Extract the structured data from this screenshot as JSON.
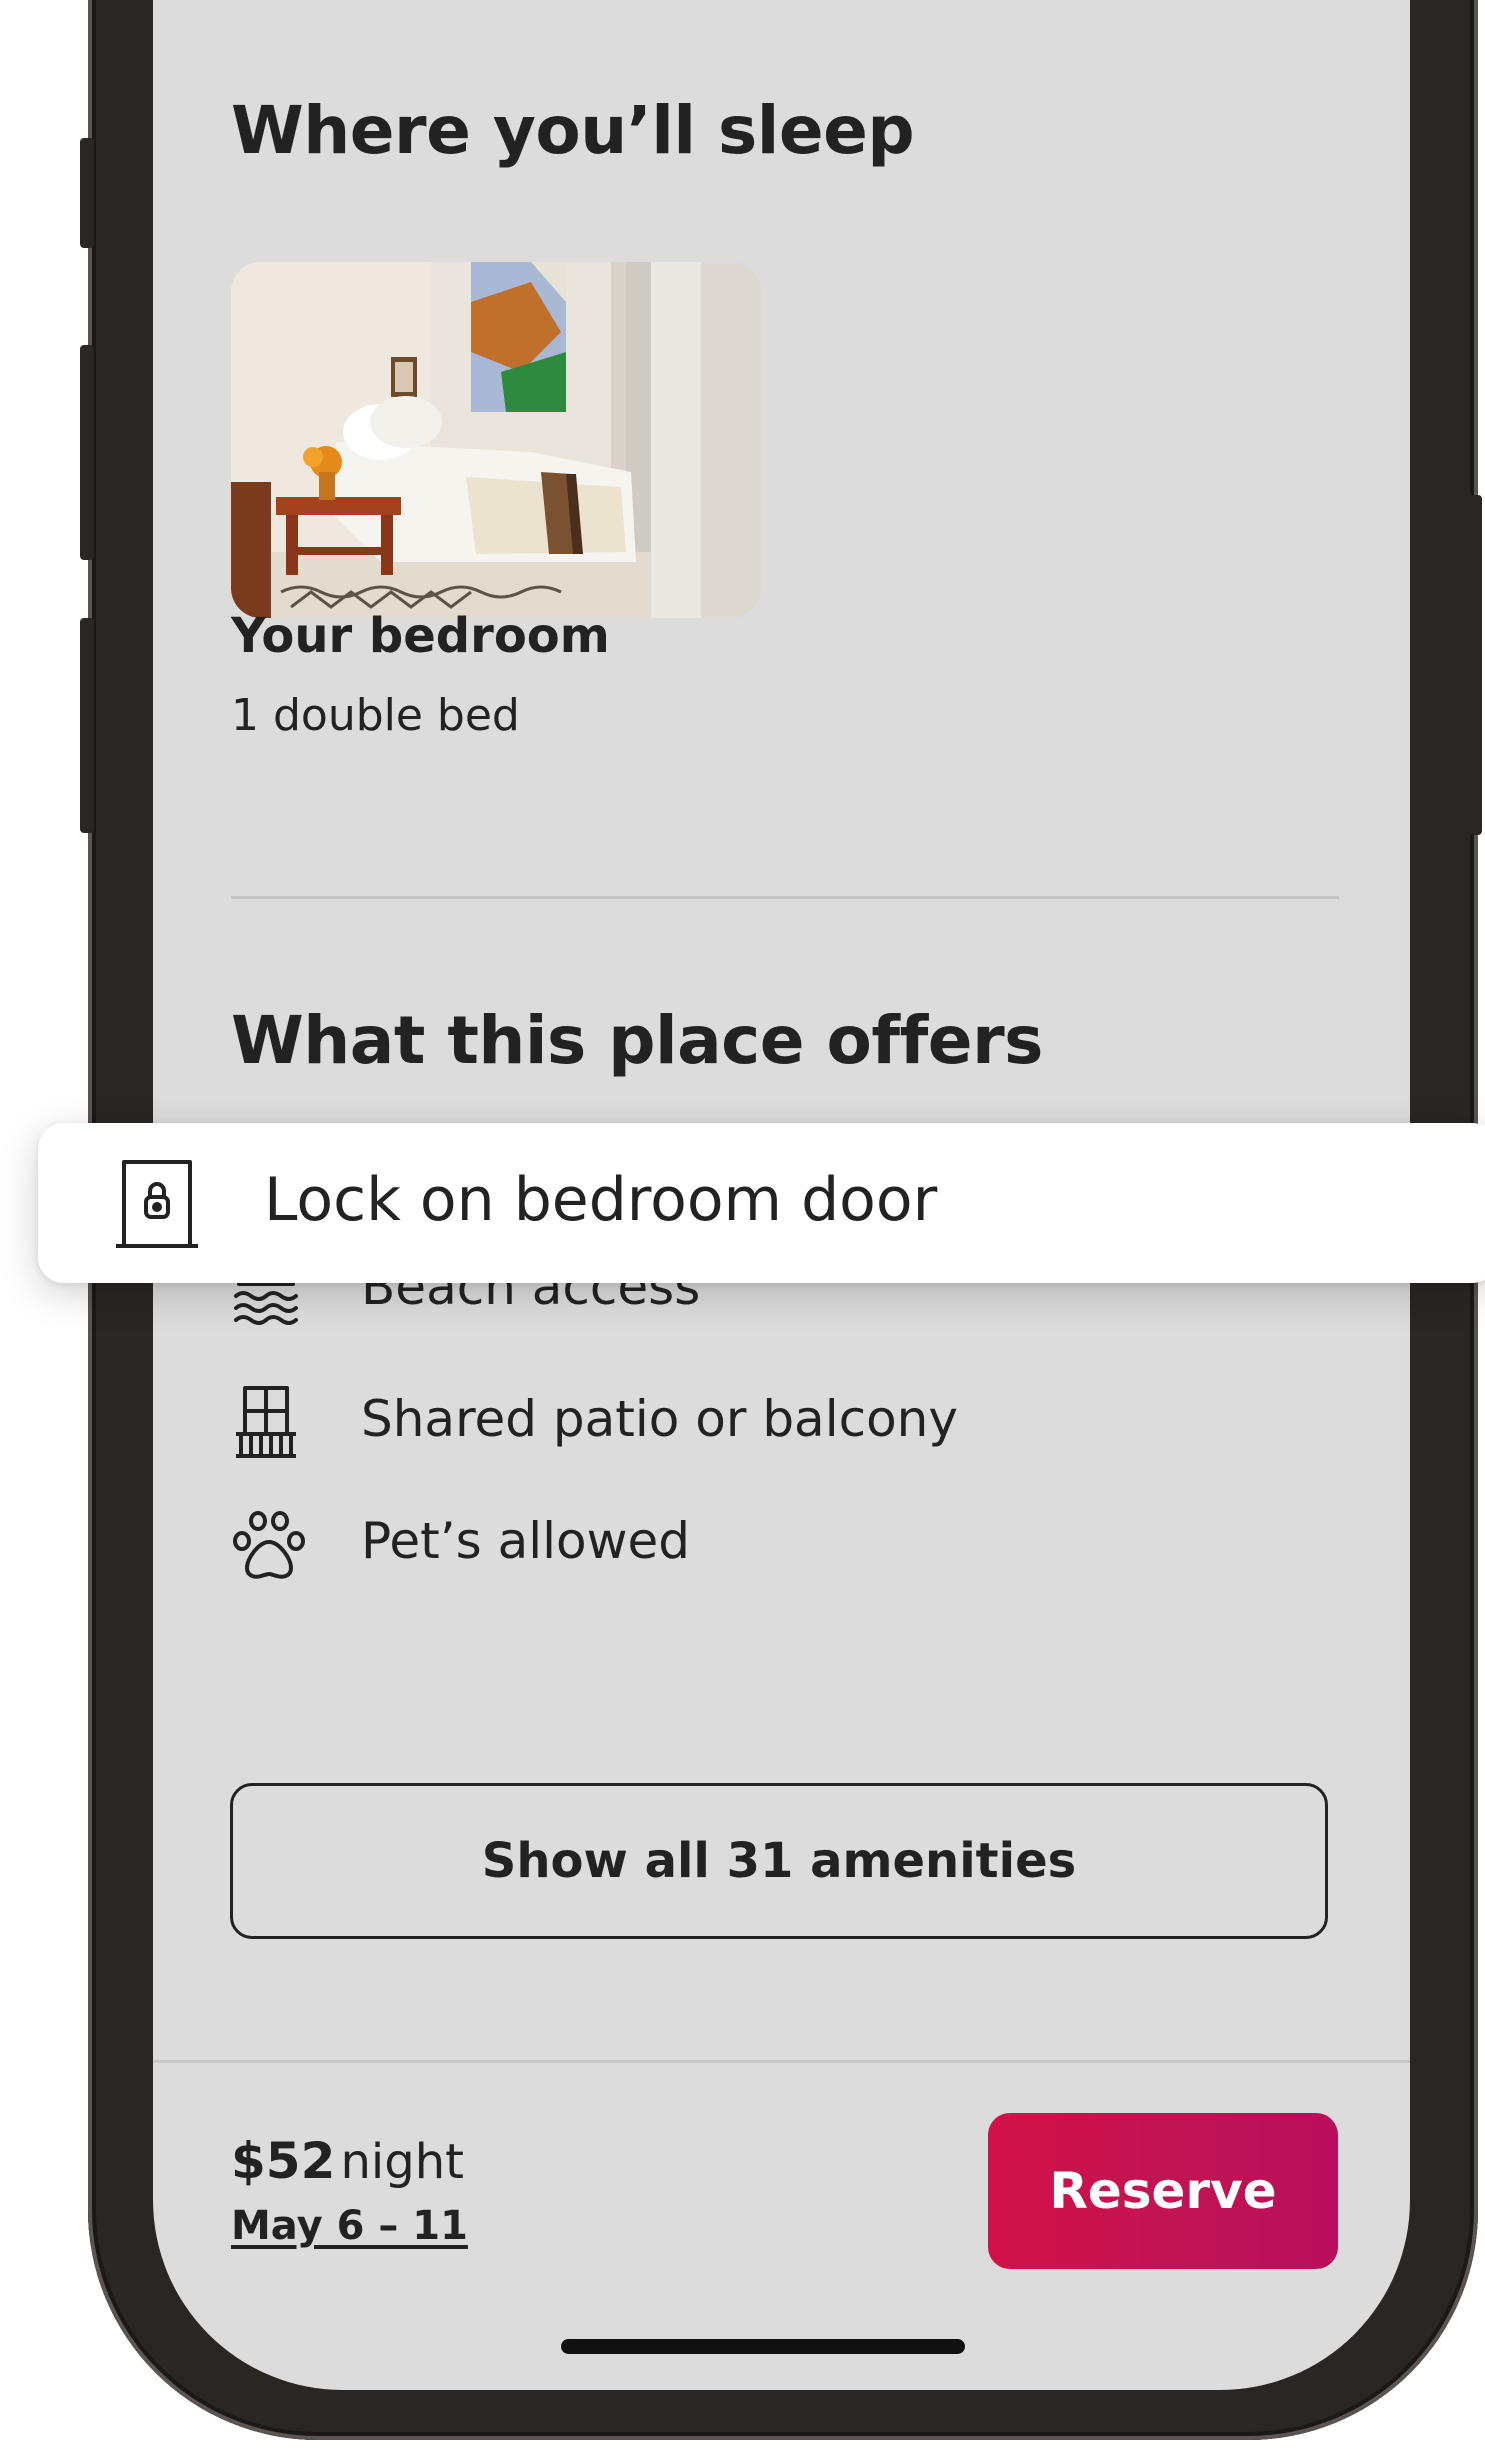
{
  "sleep_section": {
    "heading": "Where you’ll sleep",
    "room_title": "Your bedroom",
    "room_detail": "1 double bed"
  },
  "amenities_section": {
    "heading": "What this place offers",
    "highlighted": {
      "label": "Lock on bedroom door",
      "icon": "lock-door-icon"
    },
    "items": [
      {
        "label": "Beach access",
        "icon": "beach-icon"
      },
      {
        "label": "Shared patio or balcony",
        "icon": "balcony-icon"
      },
      {
        "label": "Pet’s allowed",
        "icon": "paw-icon"
      }
    ],
    "show_all_label": "Show all 31 amenities"
  },
  "footer": {
    "price": "$52",
    "price_unit": "night",
    "dates": "May 6 – 11",
    "reserve_label": "Reserve"
  },
  "colors": {
    "accent": "#d31148",
    "screen_bg": "#dcdcdc",
    "text": "#222222"
  }
}
